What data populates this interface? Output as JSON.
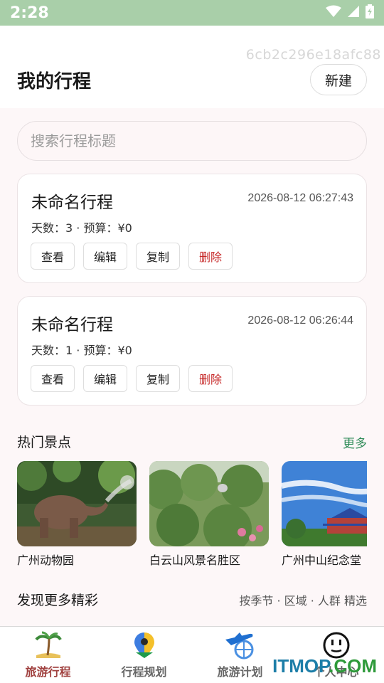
{
  "status_bar": {
    "time": "2:28",
    "icons": [
      "wifi-icon",
      "cellular-signal-icon",
      "battery-charging-icon"
    ]
  },
  "header": {
    "device_id": "6cb2c296e18afc88",
    "title": "我的行程",
    "new_button_label": "新建"
  },
  "search": {
    "placeholder": "搜索行程标题",
    "value": ""
  },
  "trips": [
    {
      "name": "未命名行程",
      "time": "2026-08-12 06:27:43",
      "meta": "天数：3 · 预算：¥0",
      "actions": [
        "查看",
        "编辑",
        "复制",
        "删除"
      ]
    },
    {
      "name": "未命名行程",
      "time": "2026-08-12 06:26:44",
      "meta": "天数：1 · 预算：¥0",
      "actions": [
        "查看",
        "编辑",
        "复制",
        "删除"
      ]
    }
  ],
  "hot_spots": {
    "title": "热门景点",
    "more_label": "更多",
    "items": [
      {
        "name": "广州动物园"
      },
      {
        "name": "白云山风景名胜区"
      },
      {
        "name": "广州中山纪念堂"
      }
    ]
  },
  "discover": {
    "title": "发现更多精彩",
    "subtitle": "按季节 · 区域 · 人群 精选"
  },
  "bottom_nav": {
    "items": [
      {
        "label": "旅游行程",
        "icon": "palm-tree-icon",
        "active": true
      },
      {
        "label": "行程规划",
        "icon": "map-pin-icon",
        "active": false
      },
      {
        "label": "旅游计划",
        "icon": "airplane-globe-icon",
        "active": false
      },
      {
        "label": "个人中心",
        "icon": "smiley-face-icon",
        "active": false
      }
    ]
  },
  "watermark": {
    "text_a": "ITMOP",
    "text_b": ".COM"
  },
  "colors": {
    "status_bar": "#a9cfa9",
    "accent_active": "#a0413f",
    "delete_red": "#c62828",
    "more_green": "#2e8b57"
  }
}
